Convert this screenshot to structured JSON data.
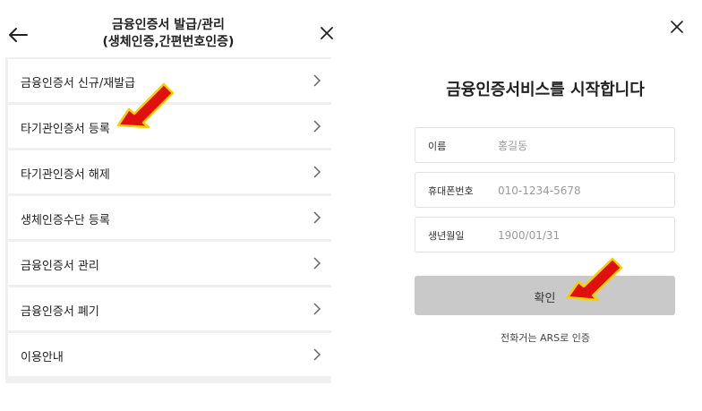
{
  "left_panel": {
    "header": {
      "title_line1": "금융인증서 발급/관리",
      "title_line2": "(생체인증,간편번호인증)",
      "back_icon": "arrow-left-icon",
      "close_icon": "close-icon"
    },
    "menu": [
      {
        "label": "금융인증서 신규/재발급"
      },
      {
        "label": "타기관인증서 등록"
      },
      {
        "label": "타기관인증서 해제"
      },
      {
        "label": "생체인증수단 등록"
      },
      {
        "label": "금융인증서 관리"
      },
      {
        "label": "금융인증서 폐기"
      },
      {
        "label": "이용안내"
      }
    ]
  },
  "right_panel": {
    "close_icon": "close-icon",
    "title": "금융인증서비스를 시작합니다",
    "fields": [
      {
        "label": "이름",
        "placeholder": "홍길동"
      },
      {
        "label": "휴대폰번호",
        "placeholder": "010-1234-5678"
      },
      {
        "label": "생년월일",
        "placeholder": "1900/01/31"
      }
    ],
    "confirm_label": "확인",
    "ars_link": "전화거는 ARS로 인증"
  },
  "colors": {
    "arrow": "#e01010",
    "arrow_outline": "#f5d000",
    "confirm_bg": "#c9c9c9",
    "panel_bg": "#f0f0f0"
  }
}
